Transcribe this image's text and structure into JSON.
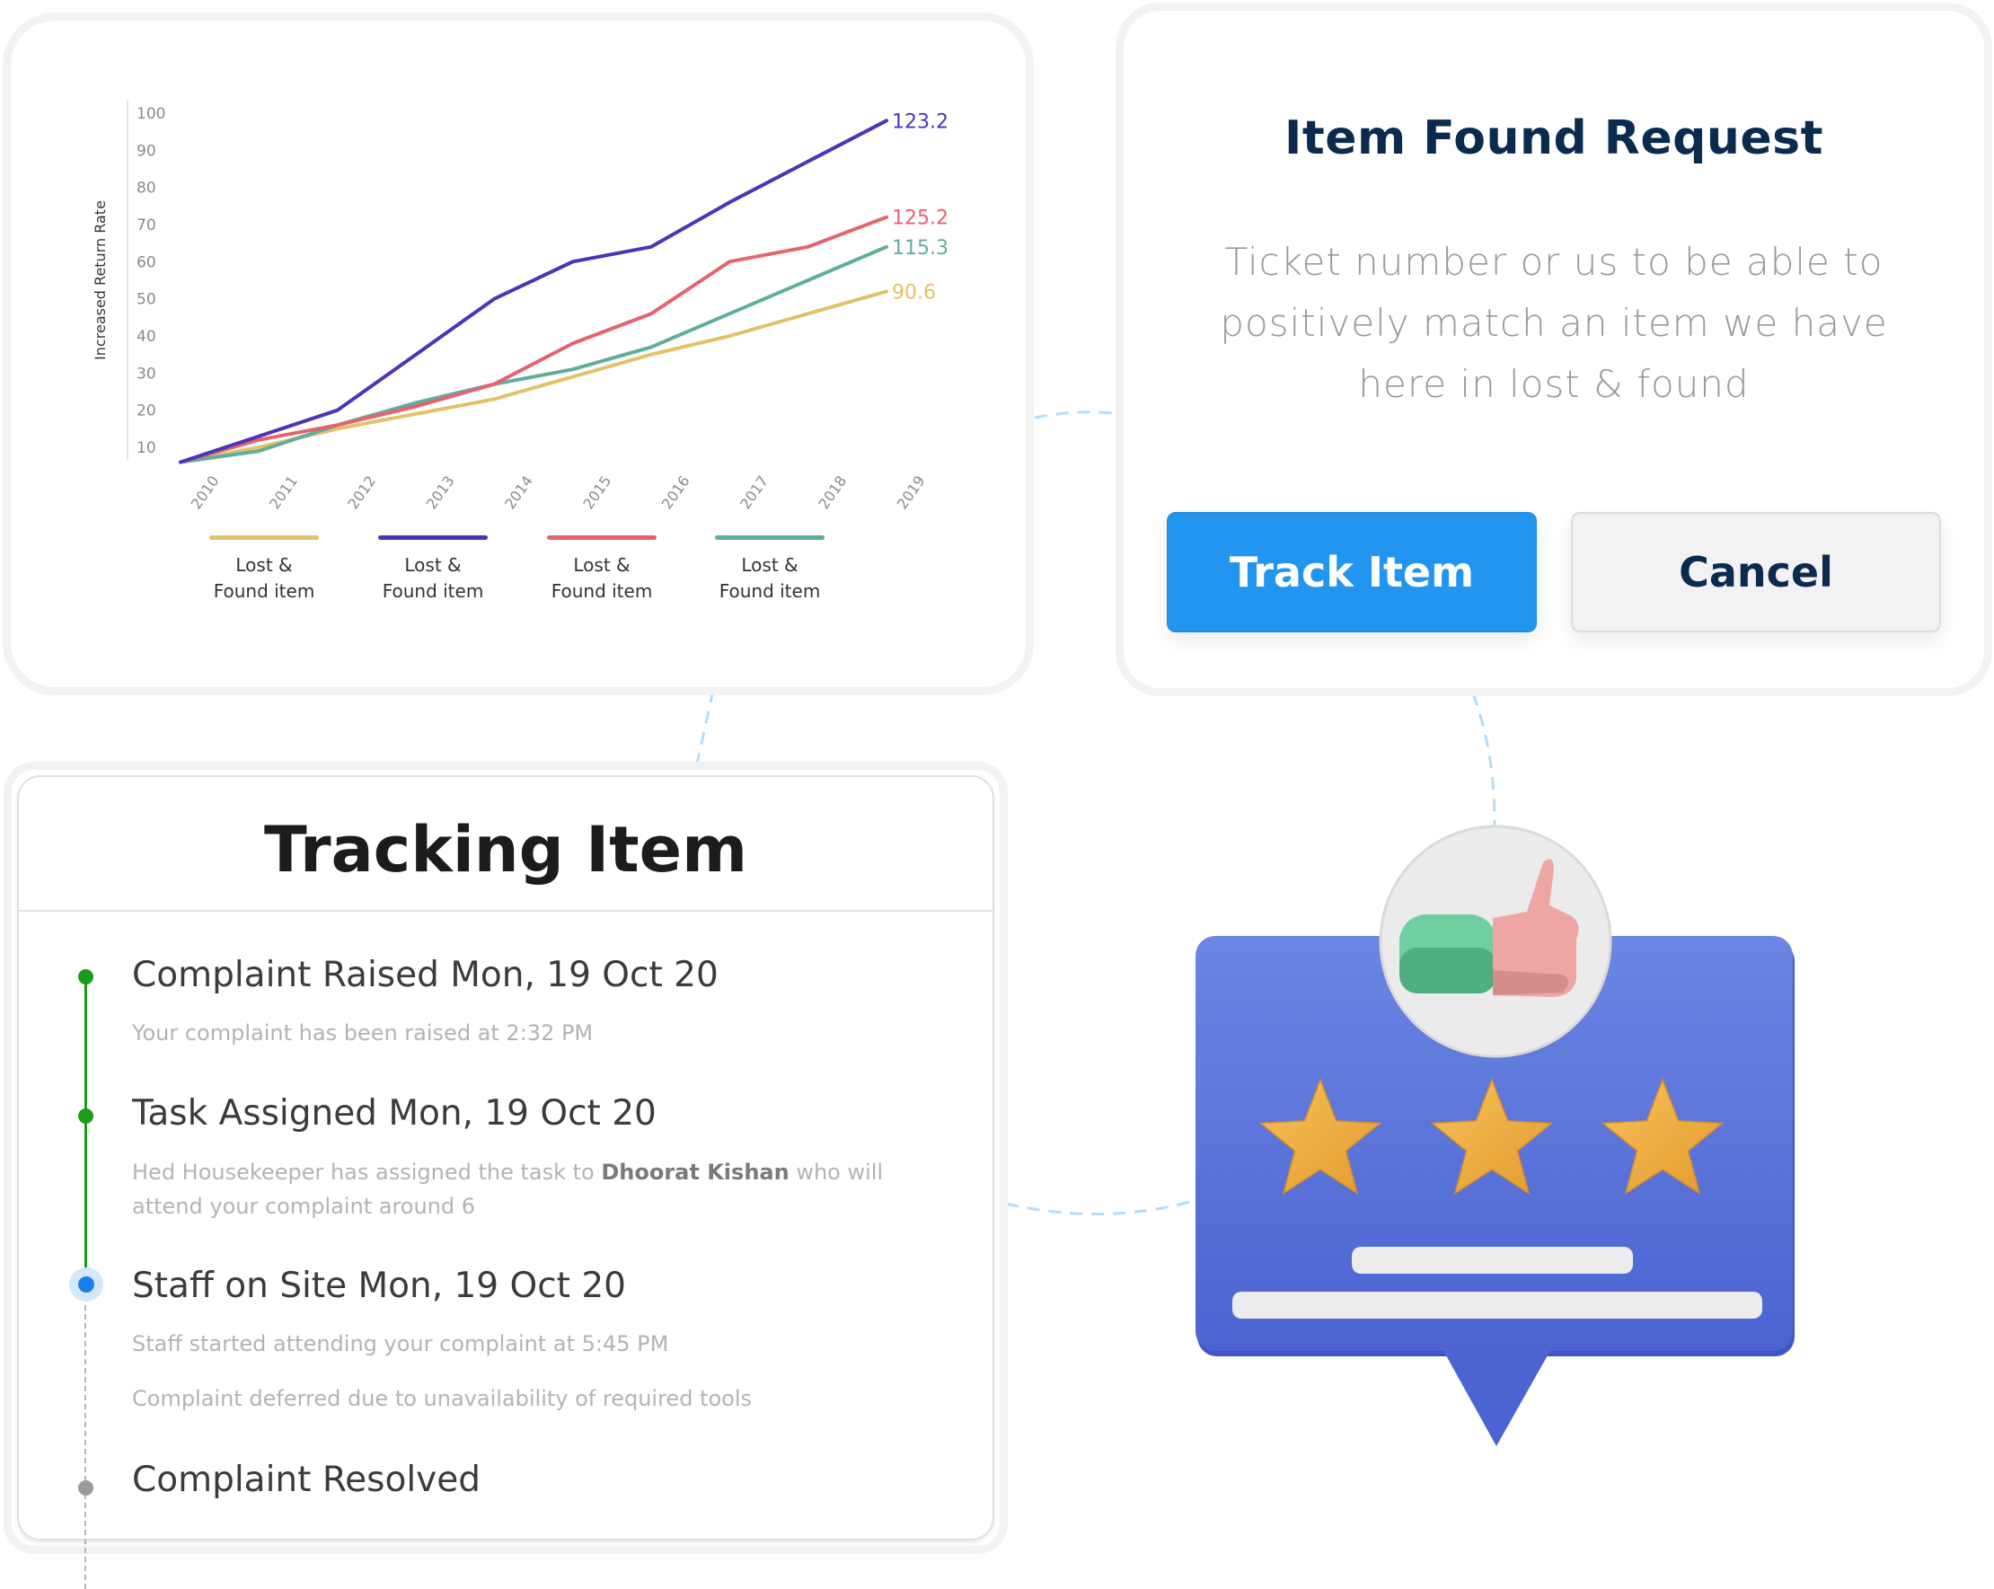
{
  "chart_card": {
    "chart_data": {
      "type": "line",
      "title": "",
      "xlabel": "",
      "ylabel": "Increased Return Rate",
      "x": [
        "2010",
        "2011",
        "2012",
        "2013",
        "2014",
        "2015",
        "2016",
        "2017",
        "2018",
        "2019"
      ],
      "y_ticks": [
        10,
        20,
        30,
        40,
        50,
        60,
        70,
        80,
        90,
        100
      ],
      "ylim": [
        6,
        100
      ],
      "grid": false,
      "legend_position": "bottom",
      "series": [
        {
          "name": "Lost & Found item",
          "color": "#e2c266",
          "values": [
            6,
            10,
            15,
            19,
            23,
            29,
            35,
            40,
            46,
            52
          ],
          "end_label": "90.6"
        },
        {
          "name": "Lost & Found item",
          "color": "#4a35b8",
          "values": [
            6,
            13,
            20,
            35,
            50,
            60,
            64,
            76,
            87,
            98
          ],
          "end_label": "123.2"
        },
        {
          "name": "Lost & Found item",
          "color": "#e5636f",
          "values": [
            6,
            12,
            16,
            21,
            27,
            38,
            46,
            60,
            64,
            72
          ],
          "end_label": "125.2"
        },
        {
          "name": "Lost & Found item",
          "color": "#5fad9c",
          "values": [
            6,
            9,
            16,
            22,
            27,
            31,
            37,
            46,
            55,
            64
          ],
          "end_label": "115.3"
        }
      ]
    },
    "legend": [
      {
        "line1": "Lost &",
        "line2": "Found item",
        "color": "#e2c266"
      },
      {
        "line1": "Lost &",
        "line2": "Found item",
        "color": "#4a35b8"
      },
      {
        "line1": "Lost &",
        "line2": "Found item",
        "color": "#e5636f"
      },
      {
        "line1": "Lost &",
        "line2": "Found item",
        "color": "#5fad9c"
      }
    ]
  },
  "request_card": {
    "title": "Item Found Request",
    "description": "Ticket number or us to be able to positively match an item we have here in lost & found",
    "track_button": "Track Item",
    "cancel_button": "Cancel",
    "accent_color": "#2295ef"
  },
  "tracking_card": {
    "title": "Tracking Item",
    "steps": [
      {
        "title": "Complaint Raised Mon, 19 Oct 20",
        "status": "done",
        "desc": "Your complaint has been raised at 2:32 PM"
      },
      {
        "title": "Task Assigned Mon, 19 Oct 20",
        "status": "done",
        "desc_pre": "Hed Housekeeper has assigned the task to ",
        "desc_bold": "Dhoorat Kishan",
        "desc_post": " who will",
        "desc_line2": "attend your complaint around 6"
      },
      {
        "title": "Staff on Site Mon, 19 Oct 20",
        "status": "current",
        "desc": "Staff started attending your complaint at 5:45 PM",
        "desc2": "Complaint deferred due to unavailability of required tools"
      },
      {
        "title": "Complaint Resolved",
        "status": "pending"
      }
    ],
    "colors": {
      "done": "#1a9b1a",
      "current": "#1a7ee8",
      "pending": "#9a9a9a"
    }
  },
  "illustration": {
    "icon": "thumbs-up-rating-icon",
    "stars": 3
  }
}
